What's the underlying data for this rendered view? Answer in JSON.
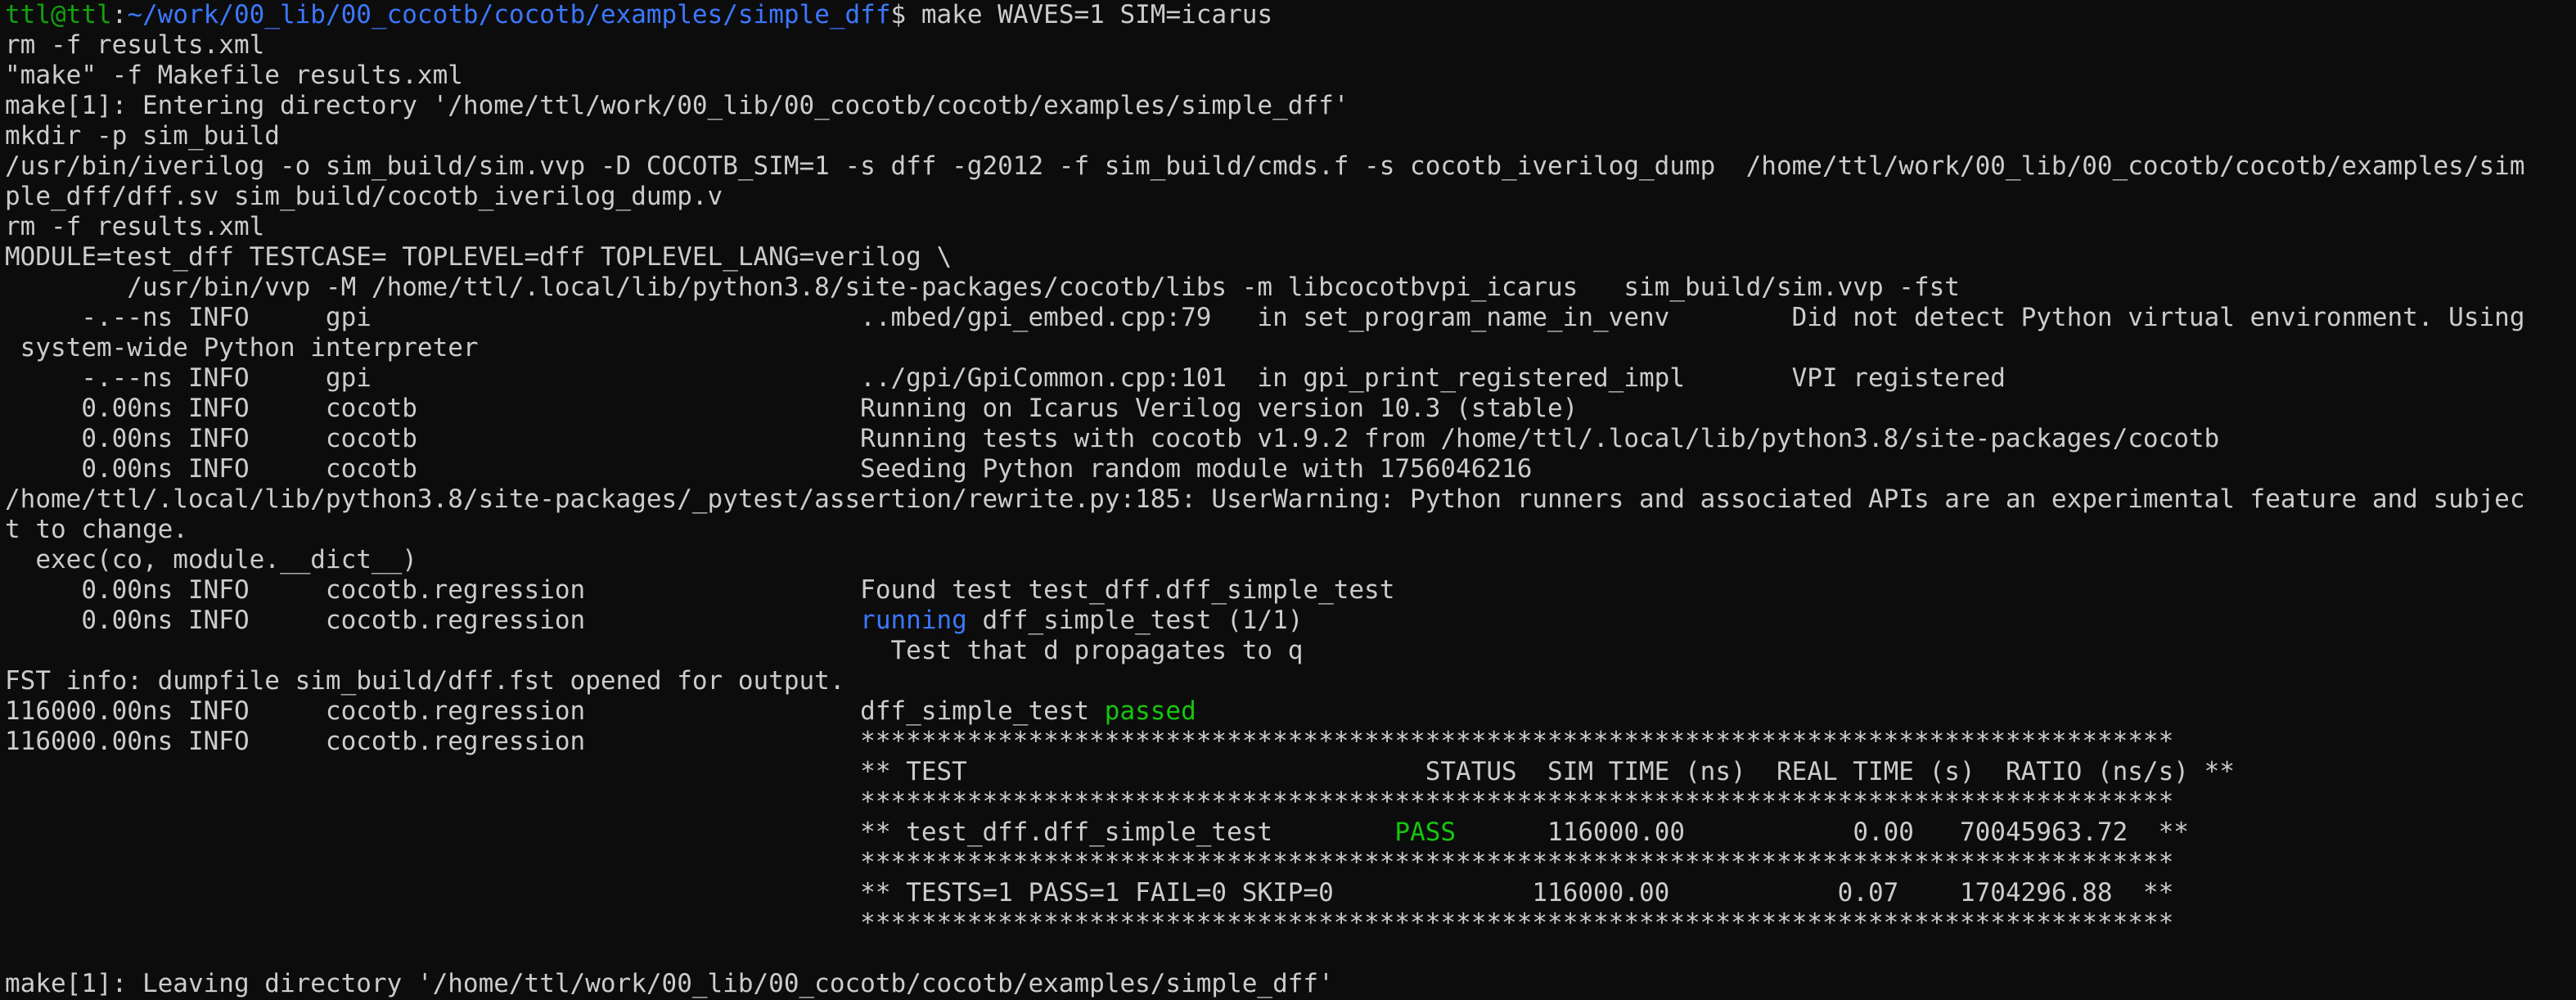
{
  "terminal": {
    "prompt": {
      "user_host": "ttl@ttl",
      "separator": ":",
      "path": "~/work/00_lib/00_cocotb/cocotb/examples/simple_dff",
      "symbol": "$",
      "command": " make WAVES=1 SIM=icarus"
    },
    "lines": [
      "rm -f results.xml",
      "\"make\" -f Makefile results.xml",
      "make[1]: Entering directory '/home/ttl/work/00_lib/00_cocotb/cocotb/examples/simple_dff'",
      "mkdir -p sim_build",
      "/usr/bin/iverilog -o sim_build/sim.vvp -D COCOTB_SIM=1 -s dff -g2012 -f sim_build/cmds.f -s cocotb_iverilog_dump  /home/ttl/work/00_lib/00_cocotb/cocotb/examples/sim",
      "ple_dff/dff.sv sim_build/cocotb_iverilog_dump.v",
      "rm -f results.xml",
      "MODULE=test_dff TESTCASE= TOPLEVEL=dff TOPLEVEL_LANG=verilog \\",
      "        /usr/bin/vvp -M /home/ttl/.local/lib/python3.8/site-packages/cocotb/libs -m libcocotbvpi_icarus   sim_build/sim.vvp -fst",
      "     -.--ns INFO     gpi                                ..mbed/gpi_embed.cpp:79   in set_program_name_in_venv        Did not detect Python virtual environment. Using",
      " system-wide Python interpreter",
      "     -.--ns INFO     gpi                                ../gpi/GpiCommon.cpp:101  in gpi_print_registered_impl       VPI registered",
      "     0.00ns INFO     cocotb                             Running on Icarus Verilog version 10.3 (stable)",
      "     0.00ns INFO     cocotb                             Running tests with cocotb v1.9.2 from /home/ttl/.local/lib/python3.8/site-packages/cocotb",
      "     0.00ns INFO     cocotb                             Seeding Python random module with 1756046216",
      "/home/ttl/.local/lib/python3.8/site-packages/_pytest/assertion/rewrite.py:185: UserWarning: Python runners and associated APIs are an experimental feature and subjec",
      "t to change.",
      "  exec(co, module.__dict__)",
      "     0.00ns INFO     cocotb.regression                  Found test test_dff.dff_simple_test"
    ],
    "running_line": {
      "prefix": "     0.00ns INFO     cocotb.regression                  ",
      "keyword": "running",
      "suffix": " dff_simple_test (1/1)"
    },
    "lines_b": [
      "                                                          Test that d propagates to q",
      "FST info: dumpfile sim_build/dff.fst opened for output."
    ],
    "passed_line": {
      "prefix": "116000.00ns INFO     cocotb.regression                  dff_simple_test ",
      "keyword": "passed"
    },
    "summary_first": "116000.00ns INFO     cocotb.regression                  **************************************************************************************",
    "summary": {
      "indent": "                                                        ",
      "stars": "**************************************************************************************",
      "header": "** TEST                              STATUS  SIM TIME (ns)  REAL TIME (s)  RATIO (ns/s) **",
      "row_prefix": "** test_dff.dff_simple_test        ",
      "row_status": "PASS",
      "row_suffix": "      116000.00           0.00   70045963.72  **",
      "totals": "** TESTS=1 PASS=1 FAIL=0 SKIP=0             116000.00           0.07    1704296.88  **"
    },
    "leaving": "make[1]: Leaving directory '/home/ttl/work/00_lib/00_cocotb/cocotb/examples/simple_dff'"
  }
}
